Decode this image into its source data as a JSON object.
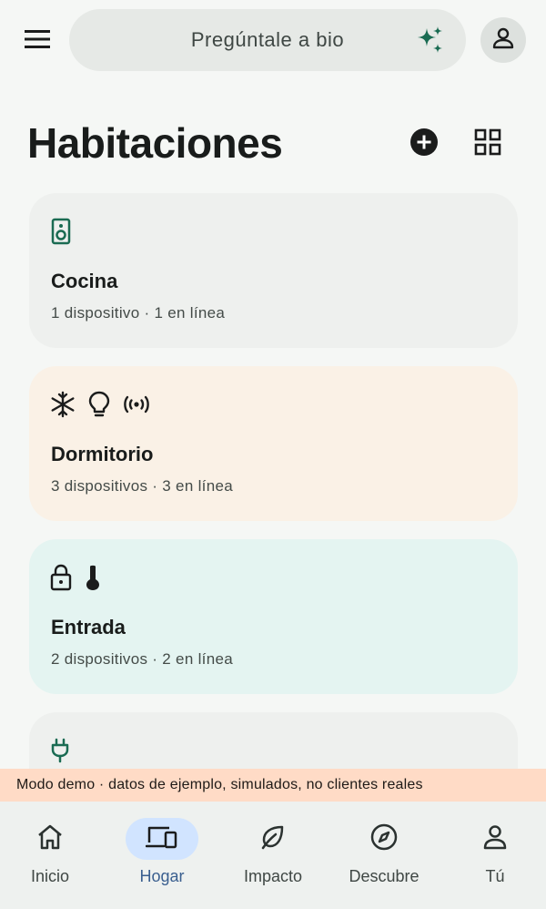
{
  "search": {
    "placeholder_text": "Pregúntale a bio"
  },
  "header": {
    "title": "Habitaciones"
  },
  "rooms": [
    {
      "name": "Cocina",
      "devices": "1 dispositivo",
      "online": "1 en línea",
      "icons": [
        "speaker-icon"
      ],
      "background": "#eef0ee"
    },
    {
      "name": "Dormitorio",
      "devices": "3 dispositivos",
      "online": "3 en línea",
      "icons": [
        "snowflake-icon",
        "lightbulb-icon",
        "sensor-icon"
      ],
      "background": "#faf1e6"
    },
    {
      "name": "Entrada",
      "devices": "2 dispositivos",
      "online": "2 en línea",
      "icons": [
        "lock-icon",
        "thermometer-icon"
      ],
      "background": "#e4f4f1"
    },
    {
      "name": "",
      "devices": "",
      "online": "",
      "icons": [
        "plug-icon"
      ],
      "background": "#eef0ee"
    }
  ],
  "separator": "·",
  "banner": {
    "text": "Modo demo · datos de ejemplo, simulados, no clientes reales"
  },
  "nav": {
    "items": [
      {
        "label": "Inicio",
        "icon": "home-icon"
      },
      {
        "label": "Hogar",
        "icon": "devices-icon",
        "active": true
      },
      {
        "label": "Impacto",
        "icon": "leaf-icon"
      },
      {
        "label": "Descubre",
        "icon": "compass-icon"
      },
      {
        "label": "Tú",
        "icon": "person-icon"
      }
    ]
  },
  "colors": {
    "accent_green": "#1a6b52",
    "active_pill": "#d1e4ff",
    "active_label": "#3a5f8f",
    "banner": "#ffdbc6"
  }
}
